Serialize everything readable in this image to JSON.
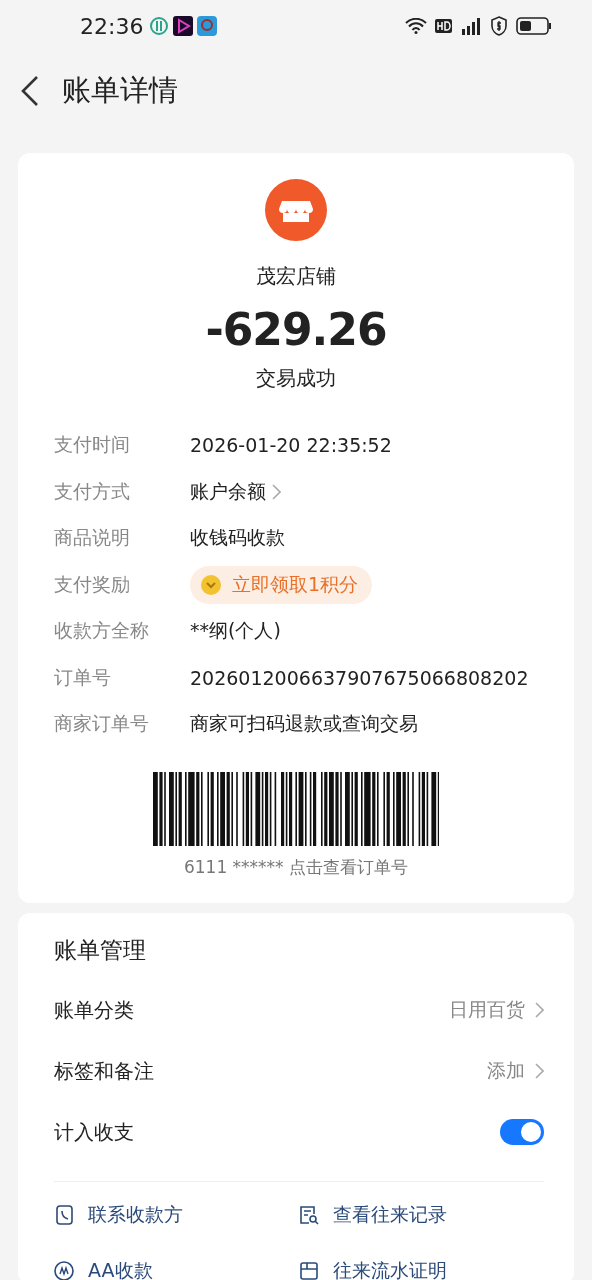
{
  "status_bar": {
    "time": "22:36"
  },
  "header": {
    "title": "账单详情"
  },
  "merchant": {
    "name": "茂宏店铺",
    "amount": "-629.26",
    "status": "交易成功"
  },
  "details": [
    {
      "label": "支付时间",
      "value": "2026-01-20 22:35:52",
      "kind": "text"
    },
    {
      "label": "支付方式",
      "value": "账户余额",
      "kind": "link"
    },
    {
      "label": "商品说明",
      "value": "收钱码收款",
      "kind": "text"
    },
    {
      "label": "支付奖励",
      "value": "立即领取1积分",
      "kind": "reward"
    },
    {
      "label": "收款方全称",
      "value": "**纲(个人)",
      "kind": "text"
    },
    {
      "label": "订单号",
      "value": "2026012006637907675066808202",
      "kind": "text"
    },
    {
      "label": "商家订单号",
      "value": "商家可扫码退款或查询交易",
      "kind": "text"
    }
  ],
  "barcode": {
    "caption": "6111 ****** 点击查看订单号"
  },
  "manage": {
    "title": "账单管理",
    "items": [
      {
        "label": "账单分类",
        "value": "日用百货",
        "kind": "link"
      },
      {
        "label": "标签和备注",
        "value": "添加",
        "kind": "link"
      },
      {
        "label": "计入收支",
        "kind": "toggle",
        "on": true
      }
    ],
    "actions": [
      {
        "label": "联系收款方"
      },
      {
        "label": "查看往来记录"
      },
      {
        "label": "AA收款"
      },
      {
        "label": "往来流水证明"
      }
    ]
  }
}
